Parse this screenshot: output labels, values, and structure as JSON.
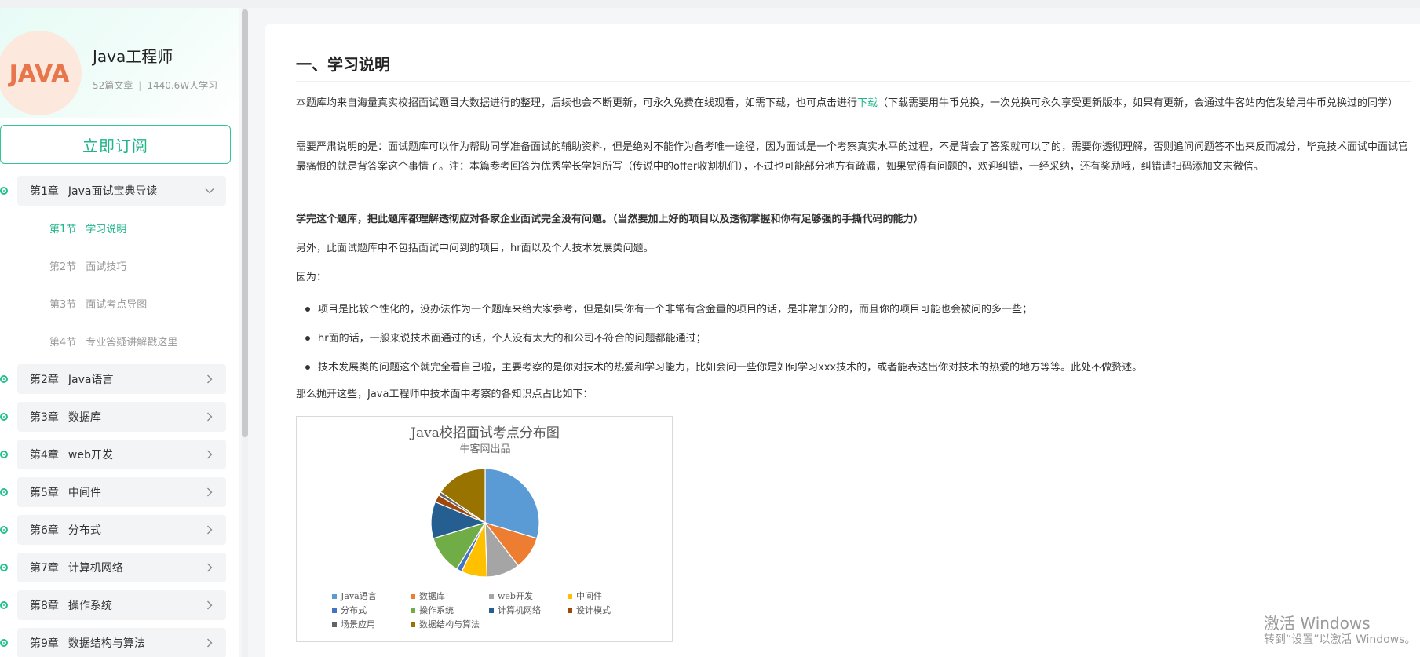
{
  "sidebar": {
    "logo_text": "JAVA",
    "course_title": "Java工程师",
    "articles": "52篇文章",
    "meta_sep": "|",
    "learners": "1440.6W人学习",
    "subscribe": "立即订阅",
    "chapters": [
      {
        "num": "第1章",
        "title": "Java面试宝典导读",
        "expanded": true
      },
      {
        "num": "第2章",
        "title": "Java语言"
      },
      {
        "num": "第3章",
        "title": "数据库"
      },
      {
        "num": "第4章",
        "title": "web开发"
      },
      {
        "num": "第5章",
        "title": "中间件"
      },
      {
        "num": "第6章",
        "title": "分布式"
      },
      {
        "num": "第7章",
        "title": "计算机网络"
      },
      {
        "num": "第8章",
        "title": "操作系统"
      },
      {
        "num": "第9章",
        "title": "数据结构与算法"
      }
    ],
    "sections": [
      {
        "num": "第1节",
        "title": "学习说明",
        "active": true
      },
      {
        "num": "第2节",
        "title": "面试技巧"
      },
      {
        "num": "第3节",
        "title": "面试考点导图"
      },
      {
        "num": "第4节",
        "title": "专业答疑讲解戳这里"
      }
    ]
  },
  "article": {
    "heading": "一、学习说明",
    "p1_before": "本题库均来自海量真实校招面试题目大数据进行的整理，后续也会不断更新，可永久免费在线观看，如需下载，也可点击进行",
    "p1_link": "下载",
    "p1_after": "（下载需要用牛币兑换，一次兑换可永久享受更新版本，如果有更新，会通过牛客站内信发给用牛币兑换过的同学）",
    "p2": "需要严肃说明的是：面试题库可以作为帮助同学准备面试的辅助资料，但是绝对不能作为备考唯一途径，因为面试是一个考察真实水平的过程，不是背会了答案就可以了的，需要你透彻理解，否则追问问题答不出来反而减分，毕竟技术面试中面试官最痛恨的就是背答案这个事情了。注：本篇参考回答为优秀学长学姐所写（传说中的offer收割机们），不过也可能部分地方有疏漏，如果觉得有问题的，欢迎纠错，一经采纳，还有奖励哦，纠错请扫码添加文末微信。",
    "p3": "学完这个题库，把此题库都理解透彻应对各家企业面试完全没有问题。（当然要加上好的项目以及透彻掌握和你有足够强的手撕代码的能力）",
    "p4": "另外，此面试题库中不包括面试中问到的项目，hr面以及个人技术发展类问题。",
    "p5": "因为：",
    "bullets": [
      "项目是比较个性化的，没办法作为一个题库来给大家参考，但是如果你有一个非常有含金量的项目的话，是非常加分的，而且你的项目可能也会被问的多一些；",
      "hr面的话，一般来说技术面通过的话，个人没有太大的和公司不符合的问题都能通过；",
      "技术发展类的问题这个就完全看自己啦，主要考察的是你对技术的热爱和学习能力，比如会问一些你是如何学习xxx技术的，或者能表达出你对技术的热爱的地方等等。此处不做赘述。"
    ],
    "p6": "那么抛开这些，Java工程师中技术面中考察的各知识点占比如下："
  },
  "chart_data": {
    "type": "pie",
    "title": "Java校招面试考点分布图",
    "subtitle": "牛客网出品",
    "legend_position": "bottom",
    "categories": [
      "Java语言",
      "数据库",
      "web开发",
      "中间件",
      "分布式",
      "操作系统",
      "计算机网络",
      "设计模式",
      "场景应用",
      "数据结构与算法"
    ],
    "values": [
      27,
      9,
      9,
      7,
      1.5,
      10.5,
      10,
      2,
      1,
      14
    ],
    "colors": [
      "#5b9bd5",
      "#ed7d31",
      "#a5a5a5",
      "#ffc000",
      "#4472c4",
      "#70ad47",
      "#255e91",
      "#9e480e",
      "#636363",
      "#997300"
    ]
  },
  "watermark": {
    "line1": "激活 Windows",
    "line2": "转到“设置”以激活 Windows。"
  }
}
